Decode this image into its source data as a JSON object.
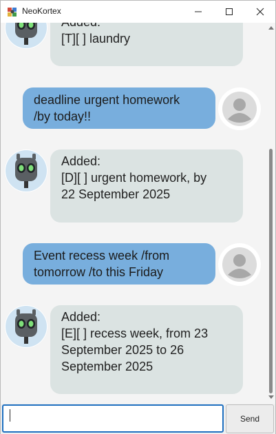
{
  "window": {
    "title": "NeoKortex",
    "minimize_icon": "minimize-icon",
    "maximize_icon": "maximize-icon",
    "close_icon": "close-icon"
  },
  "messages": [
    {
      "from": "bot",
      "lines": [
        "Added:",
        "[T][ ] laundry"
      ]
    },
    {
      "from": "user",
      "lines": [
        "deadline urgent homework",
        "/by today!!"
      ]
    },
    {
      "from": "bot",
      "lines": [
        "Added:",
        "[D][ ] urgent homework, by",
        "22 September 2025"
      ]
    },
    {
      "from": "user",
      "lines": [
        "Event recess week /from",
        "tomorrow /to this Friday"
      ]
    },
    {
      "from": "bot",
      "lines": [
        "Added:",
        "[E][ ] recess week, from 23",
        "September 2025 to 26",
        "September 2025"
      ]
    }
  ],
  "input": {
    "value": "",
    "placeholder": ""
  },
  "send_button": {
    "label": "Send"
  },
  "colors": {
    "user_bubble": "#78aedd",
    "bot_bubble": "#dbe3e2",
    "input_focus": "#1e6fc0"
  }
}
